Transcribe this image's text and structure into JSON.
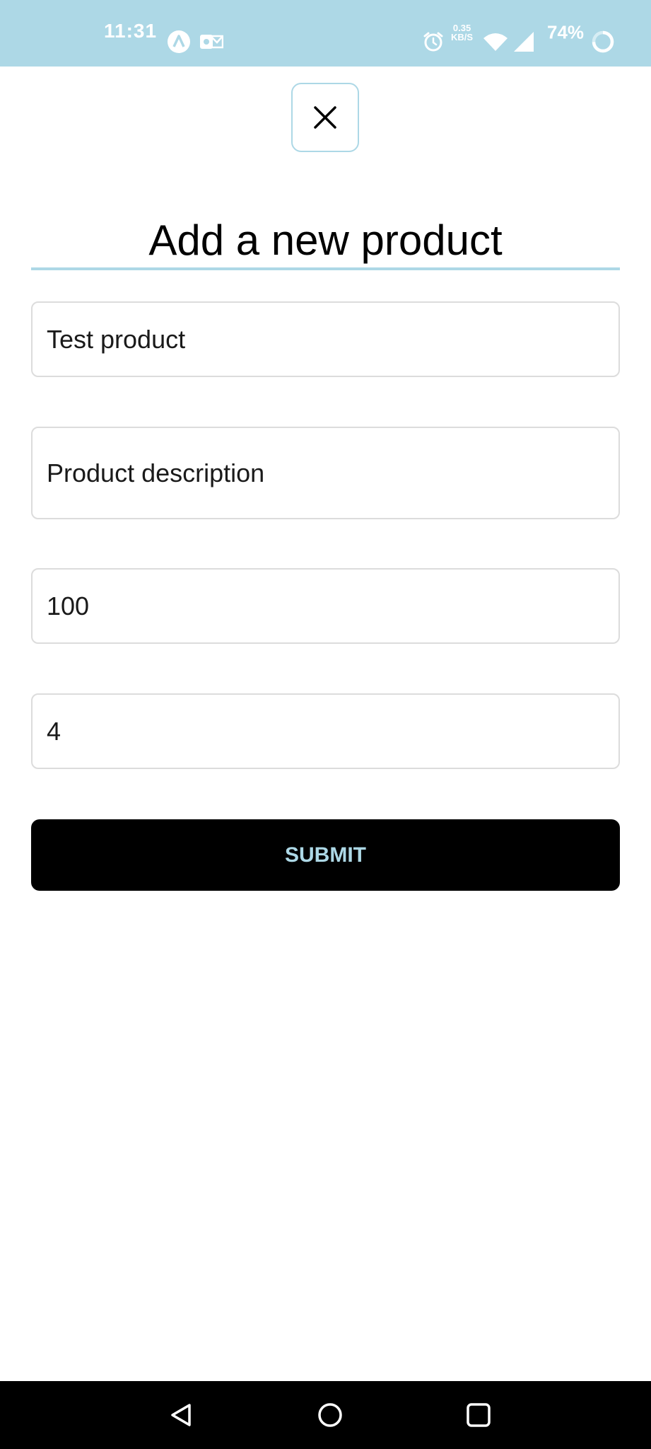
{
  "status_bar": {
    "time": "11:31",
    "network_speed_value": "0.35",
    "network_speed_unit": "KB/S",
    "battery": "74%",
    "icons": [
      "app-a-icon",
      "notification-icon",
      "alarm-icon",
      "wifi-icon",
      "signal-icon",
      "battery-ring-icon"
    ],
    "background": "#add8e6"
  },
  "form": {
    "close_icon": "close-icon",
    "title": "Add a new product",
    "fields": {
      "name": "Test product",
      "description": "Product description",
      "price": "100",
      "quantity": "4"
    },
    "submit_label": "SUBMIT"
  },
  "nav_bar": {
    "icons": [
      "back-icon",
      "home-icon",
      "recents-icon"
    ]
  },
  "colors": {
    "accent": "#add8e6",
    "button_bg": "#000000",
    "button_text": "#add8e6"
  }
}
